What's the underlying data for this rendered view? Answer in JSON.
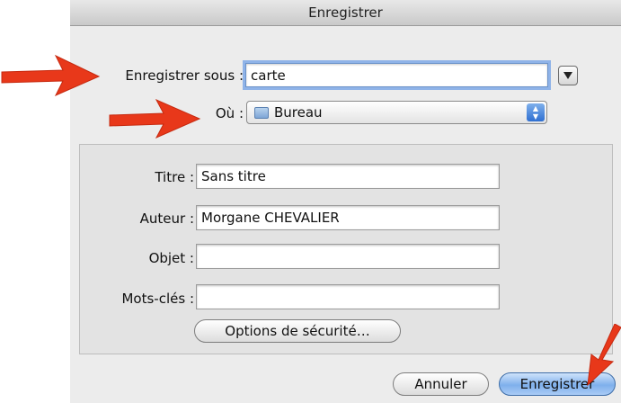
{
  "dialog": {
    "title": "Enregistrer",
    "save_as_label": "Enregistrer sous :",
    "save_as_value": "carte",
    "where_label": "Où :",
    "where_value": "Bureau",
    "metadata": {
      "title_label": "Titre :",
      "title_value": "Sans titre",
      "author_label": "Auteur :",
      "author_value": "Morgane CHEVALIER",
      "subject_label": "Objet :",
      "subject_value": "",
      "keywords_label": "Mots-clés :",
      "keywords_value": "",
      "security_button": "Options de sécurité…"
    },
    "cancel_button": "Annuler",
    "save_button": "Enregistrer"
  },
  "colors": {
    "annotation_arrow": "#e8381a",
    "focus_ring": "#8fb3e8",
    "default_button": "#7fb0ec"
  },
  "icons": {
    "expand": "triangle-down-icon",
    "folder": "folder-icon",
    "stepper": "up-down-arrows-icon"
  }
}
